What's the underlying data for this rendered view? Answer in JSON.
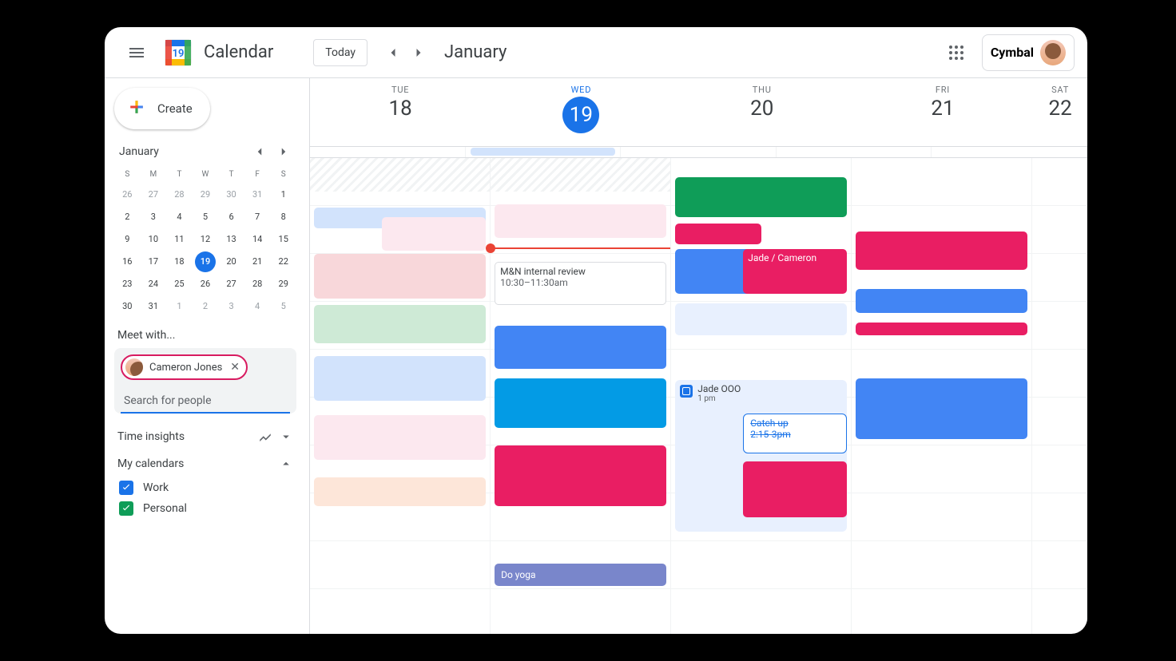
{
  "header": {
    "app_title": "Calendar",
    "today_label": "Today",
    "month_label": "January",
    "brand": "Cymbal"
  },
  "sidebar": {
    "create_label": "Create",
    "mini": {
      "month": "January",
      "dow": [
        "S",
        "M",
        "T",
        "W",
        "T",
        "F",
        "S"
      ],
      "weeks": [
        [
          {
            "n": "26",
            "m": true
          },
          {
            "n": "27",
            "m": true
          },
          {
            "n": "28",
            "m": true
          },
          {
            "n": "29",
            "m": true
          },
          {
            "n": "30",
            "m": true
          },
          {
            "n": "31",
            "m": true
          },
          {
            "n": "1"
          }
        ],
        [
          {
            "n": "2"
          },
          {
            "n": "3"
          },
          {
            "n": "4"
          },
          {
            "n": "5"
          },
          {
            "n": "6"
          },
          {
            "n": "7"
          },
          {
            "n": "8"
          }
        ],
        [
          {
            "n": "9"
          },
          {
            "n": "10"
          },
          {
            "n": "11"
          },
          {
            "n": "12"
          },
          {
            "n": "13"
          },
          {
            "n": "14"
          },
          {
            "n": "15"
          }
        ],
        [
          {
            "n": "16"
          },
          {
            "n": "17"
          },
          {
            "n": "18"
          },
          {
            "n": "19",
            "today": true
          },
          {
            "n": "20"
          },
          {
            "n": "21"
          },
          {
            "n": "22"
          }
        ],
        [
          {
            "n": "23"
          },
          {
            "n": "24"
          },
          {
            "n": "25"
          },
          {
            "n": "26"
          },
          {
            "n": "27"
          },
          {
            "n": "28"
          },
          {
            "n": "29"
          }
        ],
        [
          {
            "n": "30"
          },
          {
            "n": "31"
          },
          {
            "n": "1",
            "m": true
          },
          {
            "n": "2",
            "m": true
          },
          {
            "n": "3",
            "m": true
          },
          {
            "n": "4",
            "m": true
          },
          {
            "n": "5",
            "m": true
          }
        ]
      ]
    },
    "meet_with_title": "Meet with...",
    "chip_name": "Cameron Jones",
    "search_placeholder": "Search for people",
    "time_insights": "Time insights",
    "my_calendars": "My calendars",
    "cal_work": "Work",
    "cal_personal": "Personal"
  },
  "days": [
    {
      "dow": "TUE",
      "num": "18"
    },
    {
      "dow": "WED",
      "num": "19",
      "today": true
    },
    {
      "dow": "THU",
      "num": "20"
    },
    {
      "dow": "FRI",
      "num": "21"
    },
    {
      "dow": "SAT",
      "num": "22"
    }
  ],
  "events": {
    "mn_review_title": "M&N internal review",
    "mn_review_time": "10:30–11:30am",
    "jade_cameron": "Jade / Cameron",
    "jade_ooo": "Jade OOO",
    "jade_ooo_time": "1 pm",
    "catch_up": "Catch up",
    "catch_up_time": "2:15-3pm",
    "do_yoga": "Do yoga"
  },
  "colors": {
    "blue": "#4285f4",
    "darkblue": "#1a73e8",
    "skyblue": "#039be5",
    "pink": "#e91e63",
    "paleRed": "#f8d7da",
    "lilac": "#d6d0f0",
    "paleGreen": "#ceead6",
    "palePink": "#fce8ef",
    "green": "#0f9d58",
    "purple": "#7986cb",
    "peachy": "#fde6d9"
  }
}
